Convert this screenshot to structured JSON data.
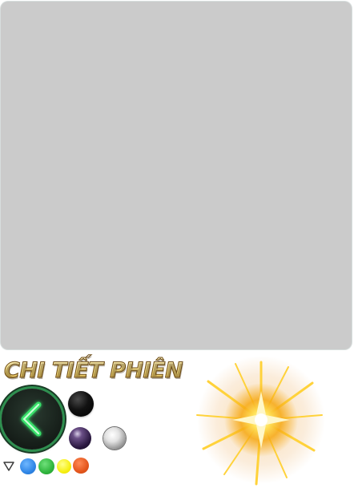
{
  "panel": {
    "color": "#cbcbcb"
  },
  "header": {
    "title": "CHI TIẾT PHIÊN"
  },
  "controls": {
    "back_icon": "chevron-left-icon",
    "accent": "#37e06a"
  },
  "orbs": [
    {
      "name": "black-orb",
      "color": "#111111"
    },
    {
      "name": "purple-orb",
      "color": "#3a2456"
    },
    {
      "name": "silver-orb",
      "color": "#cfcfcf"
    }
  ],
  "color_dots": [
    {
      "name": "blue",
      "color": "#2f86e6"
    },
    {
      "name": "green",
      "color": "#2fb53d"
    },
    {
      "name": "yellow",
      "color": "#f6ef12"
    },
    {
      "name": "orange",
      "color": "#e4561c"
    }
  ],
  "effects": {
    "burst_icon": "golden-burst-icon"
  }
}
